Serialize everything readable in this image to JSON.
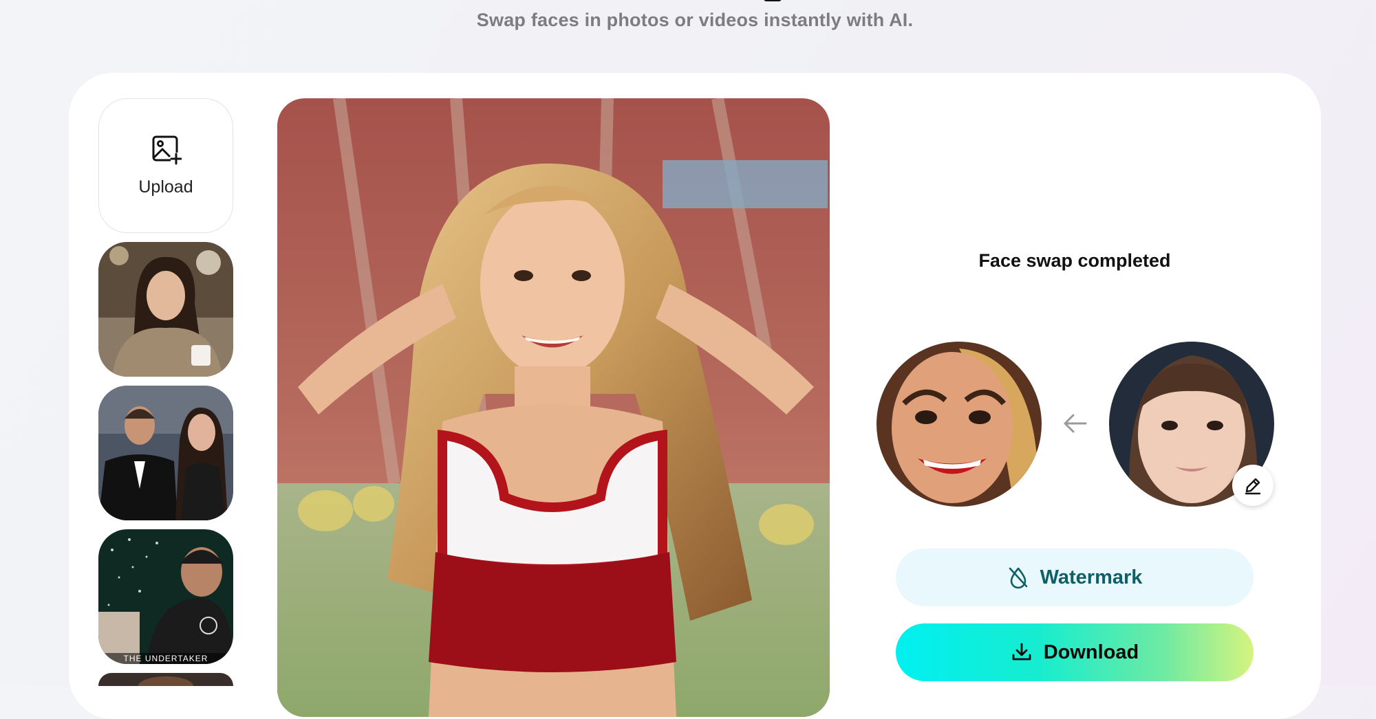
{
  "header": {
    "subtitle": "Swap faces in photos or videos instantly with AI."
  },
  "sidebar": {
    "upload_label": "Upload",
    "upload_icon": "image-plus-icon",
    "thumbnails": [
      {
        "name": "woman-cafe-sweater"
      },
      {
        "name": "couple-formal-wear"
      },
      {
        "name": "man-black-jacket",
        "caption": "THE UNDERTAKER"
      },
      {
        "name": "partial-thumbnail"
      }
    ]
  },
  "result": {
    "status": "Face swap completed",
    "arrow_icon": "arrow-left-icon",
    "edit_icon": "pencil-icon",
    "watermark_label": "Watermark",
    "watermark_icon": "droplet-off-icon",
    "download_label": "Download",
    "download_icon": "download-icon"
  },
  "colors": {
    "watermark_bg": "#e9f8fc",
    "watermark_text": "#0f5f66",
    "download_gradient_start": "#00f0f0",
    "download_gradient_end": "#d6f37e"
  }
}
